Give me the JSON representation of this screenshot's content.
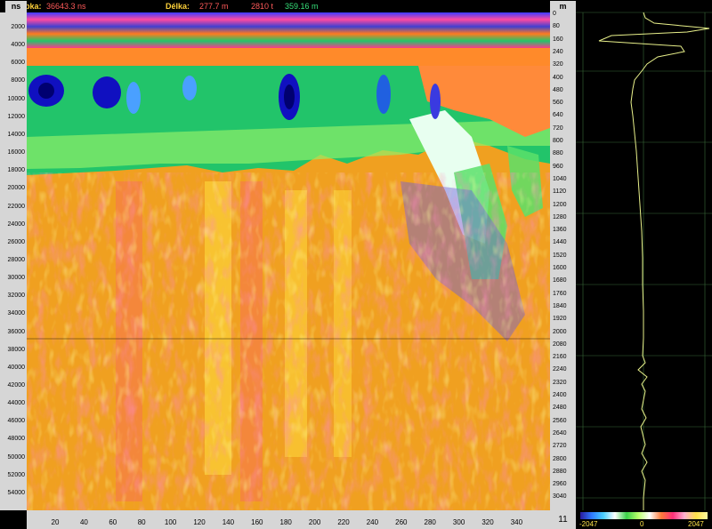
{
  "header": {
    "depth_label": "Hloubka:",
    "depth_value": "36643.3 ns",
    "length_label": "Délka:",
    "length_value": "277.7 m",
    "trace_count": "2810 t",
    "position": "359.16 m"
  },
  "left_axis": {
    "unit": "ns",
    "ticks": [
      "2000",
      "4000",
      "6000",
      "8000",
      "10000",
      "12000",
      "14000",
      "16000",
      "18000",
      "20000",
      "22000",
      "24000",
      "26000",
      "28000",
      "30000",
      "32000",
      "34000",
      "36000",
      "38000",
      "40000",
      "42000",
      "44000",
      "46000",
      "48000",
      "50000",
      "52000",
      "54000"
    ]
  },
  "right_axis": {
    "unit": "m",
    "ticks": [
      "0",
      "80",
      "160",
      "240",
      "320",
      "400",
      "480",
      "560",
      "640",
      "720",
      "800",
      "880",
      "960",
      "1040",
      "1120",
      "1200",
      "1280",
      "1360",
      "1440",
      "1520",
      "1600",
      "1680",
      "1760",
      "1840",
      "1920",
      "2000",
      "2080",
      "2160",
      "2240",
      "2320",
      "2400",
      "2480",
      "2560",
      "2640",
      "2720",
      "2800",
      "2880",
      "2960",
      "3040"
    ]
  },
  "bottom_axis": {
    "ticks": [
      "20",
      "40",
      "60",
      "80",
      "100",
      "120",
      "140",
      "160",
      "180",
      "200",
      "220",
      "240",
      "260",
      "280",
      "300",
      "320",
      "340"
    ]
  },
  "corner_value": "11",
  "amplitude_scale": {
    "min": "-2047",
    "mid": "0",
    "max": "2047"
  },
  "colors": {
    "background_orange": "#f0a020",
    "band_green": "#22c46a",
    "band_blue": "#1010c0",
    "trace_line": "#e8f08a",
    "label_yellow": "#ffd23a"
  }
}
